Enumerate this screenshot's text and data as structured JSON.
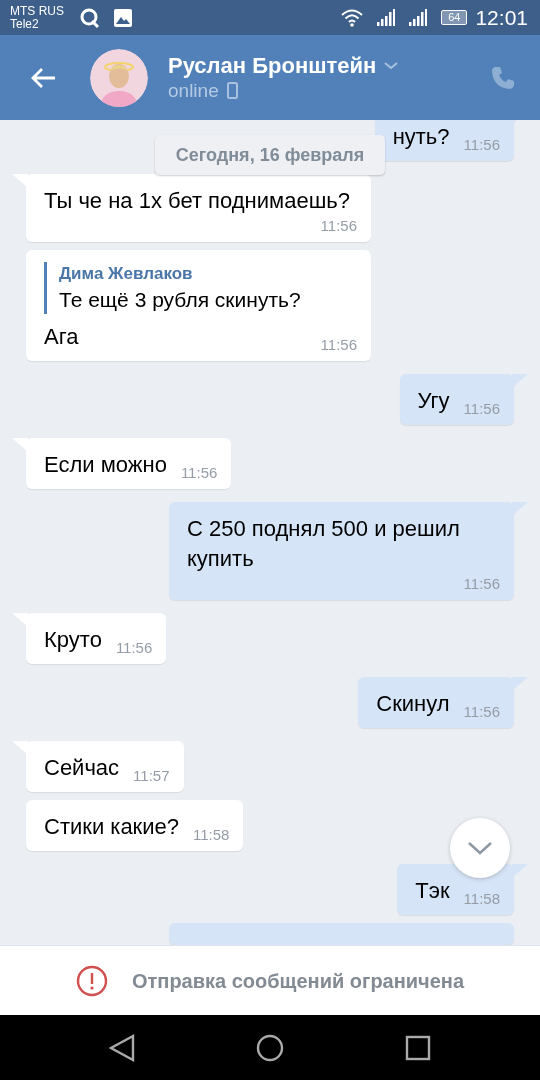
{
  "status_bar": {
    "carriers": [
      "MTS RUS",
      "Tele2"
    ],
    "battery": "64",
    "time": "12:01"
  },
  "header": {
    "name": "Руслан Бронштейн",
    "status": "online"
  },
  "date_separator": "Сегодня, 16 февраля",
  "messages": [
    {
      "kind": "out",
      "text": "нуть?",
      "time": "11:56"
    },
    {
      "kind": "in",
      "text": "Ты че на 1х бет поднимаешь?",
      "time": "11:56"
    },
    {
      "kind": "in",
      "reply_author": "Дима Жевлаков",
      "reply_text": "Те ещё 3 рубля скинуть?",
      "text": "Ага",
      "time": "11:56"
    },
    {
      "kind": "out",
      "text": "Угу",
      "time": "11:56"
    },
    {
      "kind": "in",
      "text": "Если можно",
      "time": "11:56"
    },
    {
      "kind": "out",
      "text": "С 250 поднял 500 и решил купить",
      "time": "11:56"
    },
    {
      "kind": "in",
      "text": "Круто",
      "time": "11:56"
    },
    {
      "kind": "out",
      "text": "Скинул",
      "time": "11:56"
    },
    {
      "kind": "in",
      "text": "Сейчас",
      "time": "11:57"
    },
    {
      "kind": "in",
      "text": "Стики какие?",
      "time": "11:58"
    },
    {
      "kind": "out",
      "text": "Тэк",
      "time": "11:58"
    },
    {
      "kind": "out"
    }
  ],
  "notice": "Отправка сообщений ограничена"
}
